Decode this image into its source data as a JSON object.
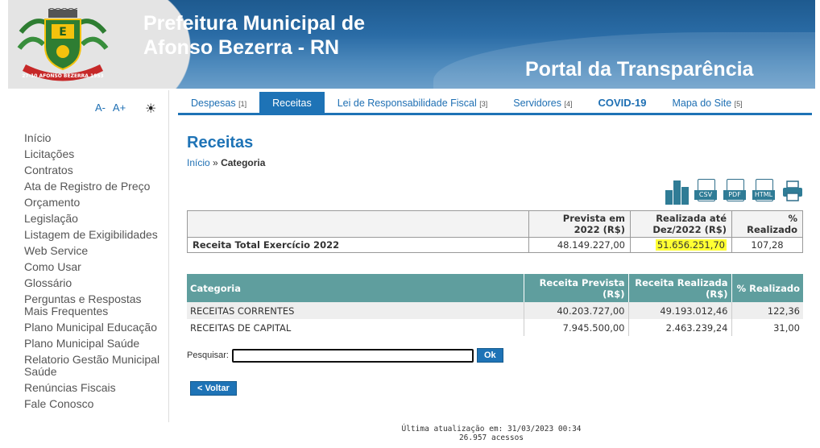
{
  "header": {
    "title_line1": "Prefeitura Municipal de",
    "title_line2": "Afonso Bezerra - RN",
    "subtitle": "Portal da Transparência",
    "logo_text": "27-10 AFONSO BEZERRA 1953"
  },
  "accessibility": {
    "font_decrease": "A-",
    "font_increase": "A+",
    "contrast_icon": "sun-icon"
  },
  "sidebar": {
    "items": [
      "Início",
      "Licitações",
      "Contratos",
      "Ata de Registro de Preço",
      "Orçamento",
      "Legislação",
      "Listagem de Exigibilidades",
      "Web Service",
      "Como Usar",
      "Glossário",
      "Perguntas e Respostas Mais Frequentes",
      "Plano Municipal Educação",
      "Plano Municipal Saúde",
      "Relatorio Gestão Municipal Saúde",
      "Renúncias Fiscais",
      "Fale Conosco"
    ]
  },
  "tabs": [
    {
      "label": "Despesas",
      "key": "[1]"
    },
    {
      "label": "Receitas",
      "key": ""
    },
    {
      "label": "Lei de Responsabilidade Fiscal",
      "key": "[3]"
    },
    {
      "label": "Servidores",
      "key": "[4]"
    },
    {
      "label": "COVID-19",
      "key": ""
    },
    {
      "label": "Mapa do Site",
      "key": "[5]"
    }
  ],
  "main": {
    "title": "Receitas",
    "breadcrumb_home": "Início",
    "breadcrumb_sep": "»",
    "breadcrumb_current": "Categoria",
    "export": {
      "csv": "CSV",
      "pdf": "PDF",
      "html": "HTML"
    }
  },
  "summary": {
    "headers": [
      "",
      "Prevista em 2022 (R$)",
      "Realizada até Dez/2022 (R$)",
      "% Realizado"
    ],
    "row": {
      "label": "Receita Total Exercício 2022",
      "prevista": "48.149.227,00",
      "realizada": "51.656.251,70",
      "percent": "107,28"
    }
  },
  "categories": {
    "headers": [
      "Categoria",
      "Receita Prevista (R$)",
      "Receita Realizada (R$)",
      "% Realizado"
    ],
    "rows": [
      {
        "name": "RECEITAS CORRENTES",
        "prevista": "40.203.727,00",
        "realizada": "49.193.012,46",
        "percent": "122,36"
      },
      {
        "name": "RECEITAS DE CAPITAL",
        "prevista": "7.945.500,00",
        "realizada": "2.463.239,24",
        "percent": "31,00"
      }
    ]
  },
  "search": {
    "label": "Pesquisar:",
    "value": "",
    "button": "Ok"
  },
  "back_button": "< Voltar",
  "footer": {
    "updated": "Última atualização em: 31/03/2023 00:34",
    "visits": "26.957 acessos"
  }
}
